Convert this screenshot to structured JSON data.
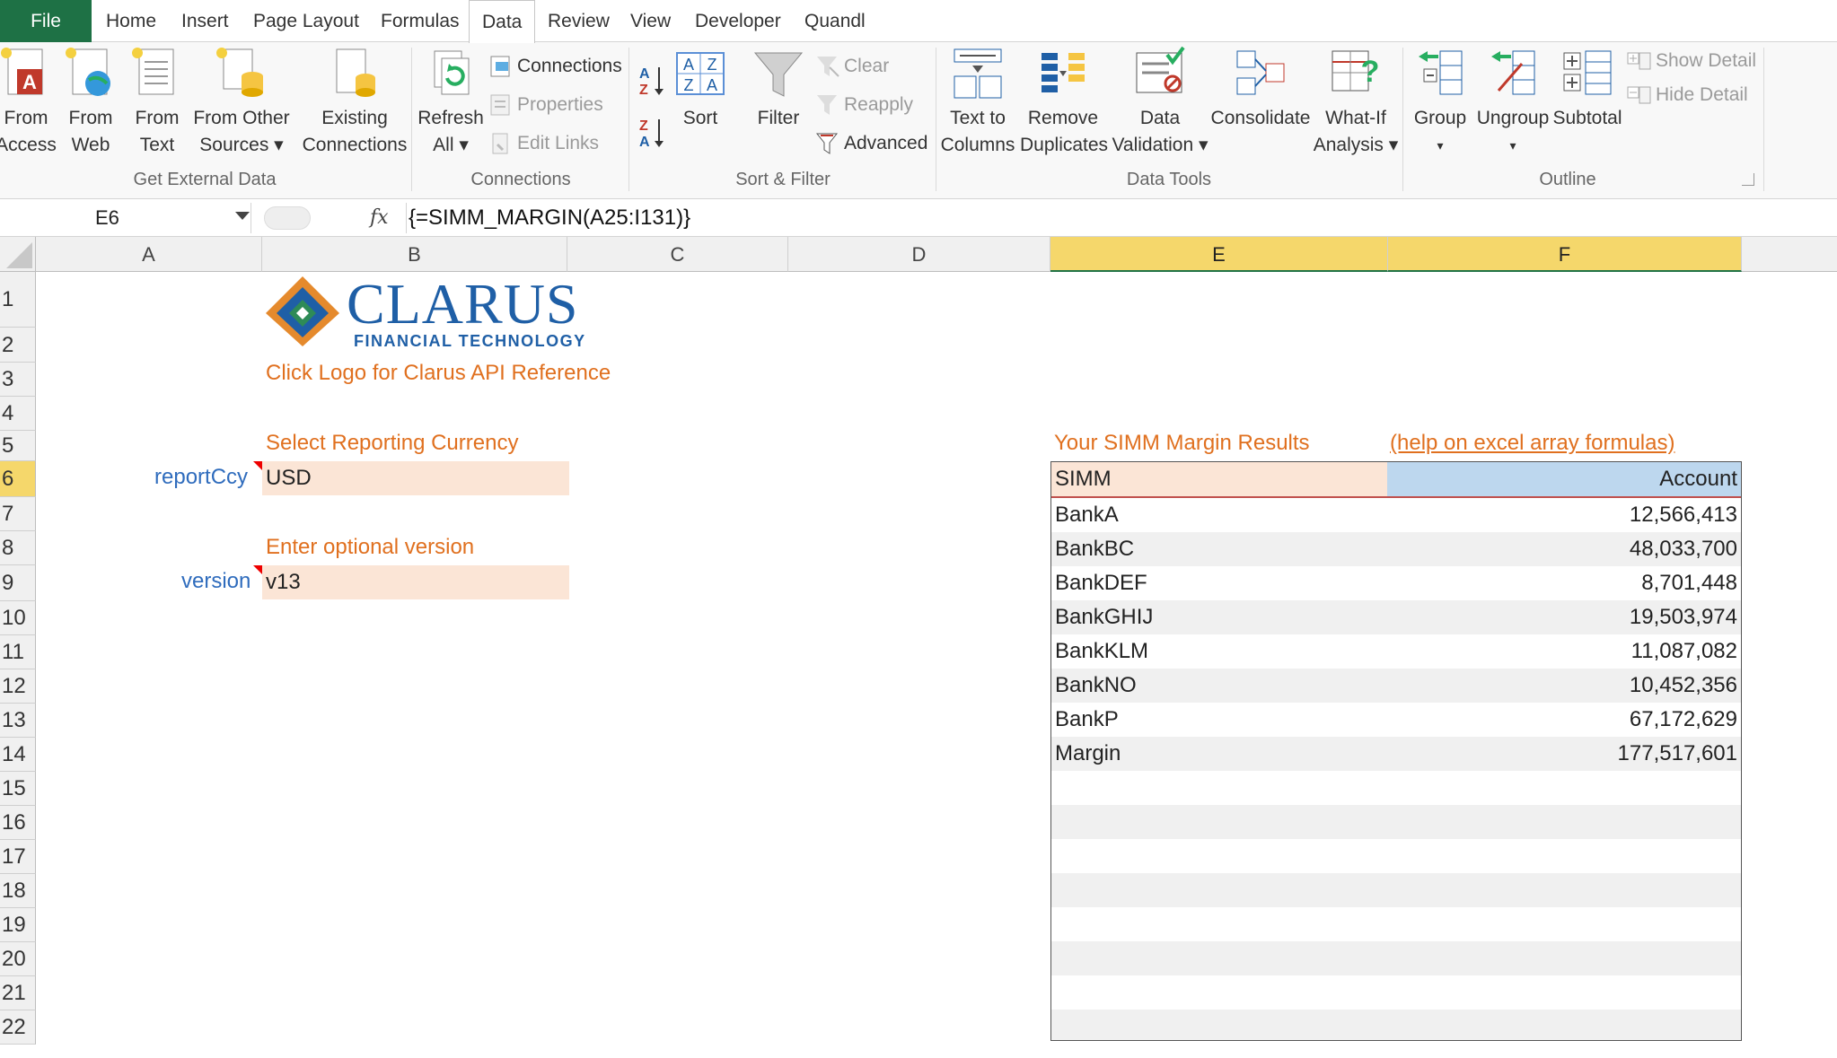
{
  "tabs": {
    "file": "File",
    "home": "Home",
    "insert": "Insert",
    "page_layout": "Page Layout",
    "formulas": "Formulas",
    "data": "Data",
    "review": "Review",
    "view": "View",
    "developer": "Developer",
    "quandl": "Quandl"
  },
  "ribbon": {
    "get_external": {
      "label": "Get External Data",
      "from_access": [
        "From",
        "Access"
      ],
      "from_web": [
        "From",
        "Web"
      ],
      "from_text": [
        "From",
        "Text"
      ],
      "from_other": [
        "From Other",
        "Sources ▾"
      ],
      "existing": [
        "Existing",
        "Connections"
      ]
    },
    "connections": {
      "label": "Connections",
      "refresh": [
        "Refresh",
        "All ▾"
      ],
      "connections": "Connections",
      "properties": "Properties",
      "edit_links": "Edit Links"
    },
    "sort_filter": {
      "label": "Sort & Filter",
      "sort": "Sort",
      "filter": "Filter",
      "clear": "Clear",
      "reapply": "Reapply",
      "advanced": "Advanced"
    },
    "data_tools": {
      "label": "Data Tools",
      "text_to_columns": [
        "Text to",
        "Columns"
      ],
      "remove_duplicates": [
        "Remove",
        "Duplicates"
      ],
      "data_validation": [
        "Data",
        "Validation ▾"
      ],
      "consolidate": "Consolidate",
      "what_if": [
        "What-If",
        "Analysis ▾"
      ]
    },
    "outline": {
      "label": "Outline",
      "group": [
        "Group",
        "▾"
      ],
      "ungroup": [
        "Ungroup",
        "▾"
      ],
      "subtotal": "Subtotal",
      "show_detail": "Show Detail",
      "hide_detail": "Hide Detail"
    }
  },
  "formula_bar": {
    "name_box": "E6",
    "fx": "fx",
    "formula": "{=SIMM_MARGIN(A25:I131)}"
  },
  "columns": [
    "A",
    "B",
    "C",
    "D",
    "E",
    "F"
  ],
  "rows": [
    "1",
    "2",
    "3",
    "4",
    "5",
    "6",
    "7",
    "8",
    "9",
    "10",
    "11",
    "12",
    "13",
    "14",
    "15",
    "16",
    "17",
    "18",
    "19",
    "20",
    "21",
    "22"
  ],
  "sheet": {
    "logo_main": "CLARUS",
    "logo_sub": "FINANCIAL TECHNOLOGY",
    "logo_link": "Click Logo for Clarus API Reference",
    "currency_prompt": "Select Reporting Currency",
    "currency_label": "reportCcy",
    "currency_value": "USD",
    "version_prompt": "Enter optional version",
    "version_label": "version",
    "version_value": "v13",
    "results_title": "Your SIMM Margin Results",
    "results_help": "(help on excel array formulas)",
    "results_header": {
      "name": "SIMM",
      "value": "Account"
    },
    "results": [
      {
        "name": "BankA",
        "value": "12,566,413"
      },
      {
        "name": "BankBC",
        "value": "48,033,700"
      },
      {
        "name": "BankDEF",
        "value": "8,701,448"
      },
      {
        "name": "BankGHIJ",
        "value": "19,503,974"
      },
      {
        "name": "BankKLM",
        "value": "11,087,082"
      },
      {
        "name": "BankNO",
        "value": "10,452,356"
      },
      {
        "name": "BankP",
        "value": "67,172,629"
      },
      {
        "name": "Margin",
        "value": "177,517,601"
      }
    ]
  },
  "colors": {
    "file_tab": "#1e7145",
    "orange_text": "#e0701f",
    "blue_label": "#2f6cbd",
    "input_fill": "#fbe5d6",
    "selected_header": "#f5d76b",
    "account_fill": "#bdd7ee"
  }
}
